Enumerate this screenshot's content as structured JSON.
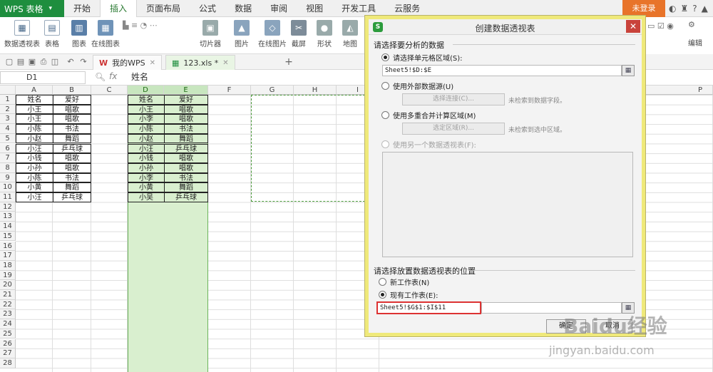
{
  "app": {
    "name": "WPS 表格"
  },
  "menu": {
    "tabs": [
      "开始",
      "插入",
      "页面布局",
      "公式",
      "数据",
      "审阅",
      "视图",
      "开发工具",
      "云服务"
    ],
    "active": "插入",
    "login": "未登录"
  },
  "ribbon": {
    "buttons": [
      "数据透视表",
      "表格",
      "图表",
      "在线图表",
      "切片器",
      "图片",
      "在线图片",
      "截屏",
      "形状",
      "地图"
    ],
    "right_label": "编辑"
  },
  "tabs": {
    "mywps": "我的WPS",
    "file": "123.xls *"
  },
  "formula": {
    "namebox": "D1",
    "fx": "fx",
    "content": "姓名"
  },
  "grid": {
    "columns": [
      "A",
      "B",
      "C",
      "D",
      "E",
      "F",
      "G",
      "H",
      "I",
      "P"
    ],
    "rows": [
      "1",
      "2",
      "3",
      "4",
      "5",
      "6",
      "7",
      "8",
      "9",
      "10",
      "11",
      "12",
      "13",
      "14",
      "15",
      "16",
      "17",
      "18",
      "19",
      "20",
      "21",
      "22",
      "23",
      "24",
      "25",
      "26",
      "27",
      "28"
    ],
    "tableA": [
      [
        "姓名",
        "爱好"
      ],
      [
        "小王",
        "唱歌"
      ],
      [
        "小王",
        "唱歌"
      ],
      [
        "小陈",
        "书法"
      ],
      [
        "小赵",
        "舞蹈"
      ],
      [
        "小汪",
        "乒乓球"
      ],
      [
        "小钱",
        "唱歌"
      ],
      [
        "小孙",
        "唱歌"
      ],
      [
        "小陈",
        "书法"
      ],
      [
        "小黄",
        "舞蹈"
      ],
      [
        "小汪",
        "乒乓球"
      ]
    ],
    "tableD": [
      [
        "姓名",
        "爱好"
      ],
      [
        "小王",
        "唱歌"
      ],
      [
        "小李",
        "唱歌"
      ],
      [
        "小陈",
        "书法"
      ],
      [
        "小赵",
        "舞蹈"
      ],
      [
        "小汪",
        "乒乓球"
      ],
      [
        "小钱",
        "唱歌"
      ],
      [
        "小孙",
        "唱歌"
      ],
      [
        "小李",
        "书法"
      ],
      [
        "小黄",
        "舞蹈"
      ],
      [
        "小吴",
        "乒乓球"
      ]
    ]
  },
  "dialog": {
    "title": "创建数据透视表",
    "section1": "请选择要分析的数据",
    "opt_range": "请选择单元格区域(S):",
    "range_value": "Sheet5!$D:$E",
    "opt_external": "使用外部数据源(U)",
    "choose_conn": "选择连接(C)...",
    "no_field": "未检索到数据字段。",
    "opt_multi": "使用多重合并计算区域(M)",
    "choose_range": "选定区域(R)...",
    "no_range": "未检索到选中区域。",
    "opt_other": "使用另一个数据透视表(F):",
    "section2": "请选择放置数据透视表的位置",
    "opt_new": "新工作表(N)",
    "opt_existing": "现有工作表(E):",
    "dest_value": "Sheet5!$G$1:$I$11",
    "ok": "确定",
    "cancel": "取消"
  },
  "watermark": {
    "text": "Baidu经验",
    "url": "jingyan.baidu.com"
  }
}
